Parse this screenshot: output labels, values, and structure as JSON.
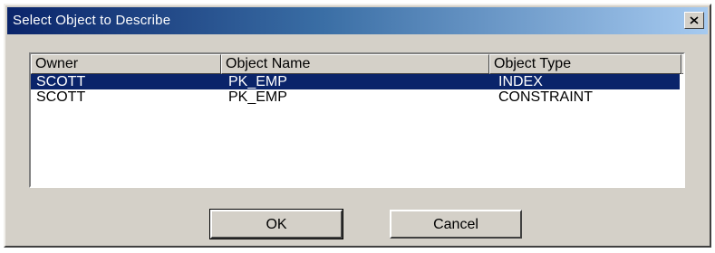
{
  "dialog": {
    "title": "Select Object to Describe",
    "close_glyph": "x"
  },
  "list": {
    "columns": [
      "Owner",
      "Object Name",
      "Object Type"
    ],
    "rows": [
      {
        "owner": "SCOTT",
        "name": "PK_EMP",
        "type": "INDEX",
        "selected": true
      },
      {
        "owner": "SCOTT",
        "name": "PK_EMP",
        "type": "CONSTRAINT",
        "selected": false
      }
    ]
  },
  "buttons": {
    "ok": "OK",
    "cancel": "Cancel"
  },
  "colors": {
    "selection": "#0a246a",
    "face": "#d4d0c8"
  },
  "icons": [
    "close-icon"
  ]
}
